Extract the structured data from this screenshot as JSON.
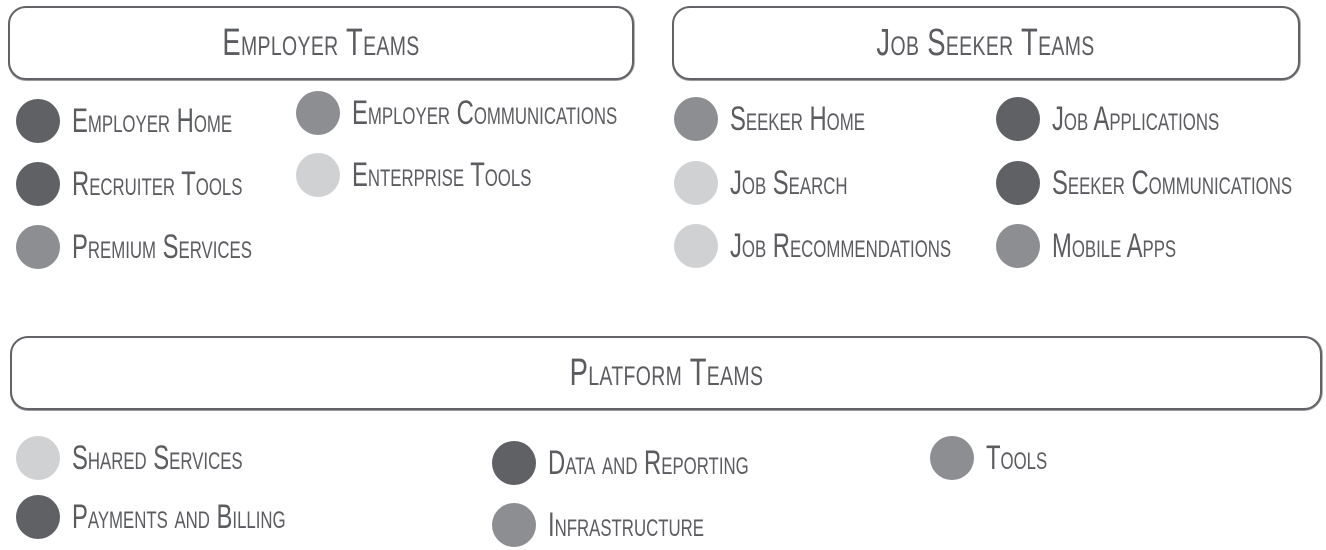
{
  "colors": {
    "dark": "#606165",
    "medium": "#8d8e91",
    "light": "#d0d1d3",
    "text": "#5b5c60",
    "border": "#626367"
  },
  "groups": {
    "employer": {
      "title": "Employer Teams",
      "items": [
        {
          "label": "Employer Home",
          "tone": "dark"
        },
        {
          "label": "Recruiter Tools",
          "tone": "dark"
        },
        {
          "label": "Premium Services",
          "tone": "medium"
        },
        {
          "label": "Employer Communications",
          "tone": "medium"
        },
        {
          "label": "Enterprise Tools",
          "tone": "light"
        }
      ]
    },
    "seeker": {
      "title": "Job Seeker Teams",
      "items": [
        {
          "label": "Seeker Home",
          "tone": "medium"
        },
        {
          "label": "Job Search",
          "tone": "light"
        },
        {
          "label": "Job Recommendations",
          "tone": "light"
        },
        {
          "label": "Job Applications",
          "tone": "dark"
        },
        {
          "label": "Seeker Communications",
          "tone": "dark"
        },
        {
          "label": "Mobile Apps",
          "tone": "medium"
        }
      ]
    },
    "platform": {
      "title": "Platform Teams",
      "items": [
        {
          "label": "Shared Services",
          "tone": "light"
        },
        {
          "label": "Payments and Billing",
          "tone": "dark"
        },
        {
          "label": "Data and Reporting",
          "tone": "dark"
        },
        {
          "label": "Infrastructure",
          "tone": "medium"
        },
        {
          "label": "Tools",
          "tone": "medium"
        }
      ]
    }
  }
}
